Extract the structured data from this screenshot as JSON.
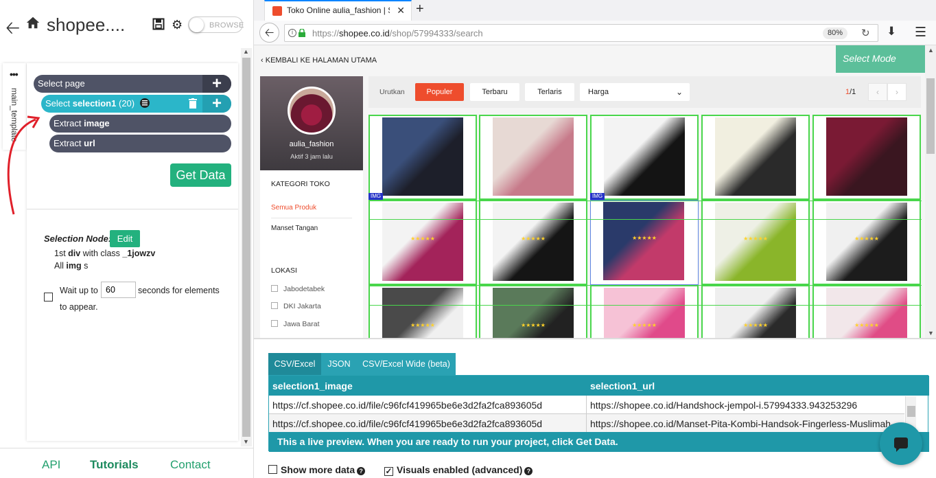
{
  "left_panel": {
    "project_title": "shopee....",
    "browse_label": "BROWSE",
    "template_tab": "main_template",
    "commands": {
      "select_page": {
        "verb": "Select",
        "target": "page"
      },
      "select_selection": {
        "verb": "Select",
        "target": "selection1",
        "count": "(20)"
      },
      "extract_image": {
        "verb": "Extract",
        "target": "image"
      },
      "extract_url": {
        "verb": "Extract",
        "target": "url"
      }
    },
    "get_data_label": "Get Data",
    "selection_node": {
      "label": "Selection Node:",
      "edit_label": "Edit",
      "line1_pre": "1st",
      "line1_tag": "div",
      "line1_mid": "with class",
      "line1_class": "_1jowzv",
      "line2_pre": "All",
      "line2_tag": "img",
      "line2_post": "s"
    },
    "wait": {
      "pre": "Wait up to",
      "value": "60",
      "post": "seconds for elements",
      "post2": "to appear."
    },
    "footer": {
      "api": "API",
      "tutorials": "Tutorials",
      "contact": "Contact"
    }
  },
  "browser": {
    "tab_title": "Toko Online aulia_fashion | S",
    "url_prefix": "https://",
    "url_domain": "shopee.co.id",
    "url_path": "/shop/57994333/search",
    "zoom": "80%"
  },
  "page": {
    "back_link": "KEMBALI KE HALAMAN UTAMA",
    "select_mode": "Select Mode",
    "shop_name": "aulia_fashion",
    "shop_active": "Aktif 3 jam lalu",
    "category_title": "KATEGORI TOKO",
    "categories": [
      "Semua Produk",
      "Manset Tangan"
    ],
    "location_title": "LOKASI",
    "locations": [
      "Jabodetabek",
      "DKI Jakarta",
      "Jawa Barat"
    ],
    "sort": {
      "label": "Urutkan",
      "popular": "Populer",
      "newest": "Terbaru",
      "top": "Terlaris",
      "price": "Harga",
      "page_current": "1",
      "page_total": "/1"
    },
    "img_tag": "IMG",
    "product_images": [
      "handsock-blue",
      "handsock-pink-bows",
      "handsock-jempol-black",
      "handsock-flower-white",
      "handsock-maroon",
      "handsock-pink-lace",
      "handsock-jempol-hitam",
      "handsock-colors",
      "handsock-green",
      "hijab-black-niqab",
      "handsock-set",
      "hijab-niqab",
      "handsock-pink-bow",
      "handsock-bow-set",
      "handsock-pink"
    ],
    "colors": {
      "shopee": "#ee4d2d",
      "selector": "#49d64b",
      "select_mode": "#5cbf9a"
    }
  },
  "preview": {
    "tabs": [
      "CSV/Excel",
      "JSON",
      "CSV/Excel Wide (beta)"
    ],
    "columns": [
      "selection1_image",
      "selection1_url"
    ],
    "rows": [
      [
        "https://cf.shopee.co.id/file/c96fcf419965be6e3d2fa2fca893605d",
        "https://shopee.co.id/Handshock-jempol-i.57994333.943253296"
      ],
      [
        "https://cf.shopee.co.id/file/c96fcf419965be6e3d2fa2fca893605d",
        "https://shopee.co.id/Manset-Pita-Kombi-Handsok-Fingerless-Muslimah-"
      ]
    ],
    "live_note": "This a live preview. When you are ready to run your project, click Get Data.",
    "show_more": "Show more data",
    "visuals": "Visuals enabled (advanced)"
  }
}
